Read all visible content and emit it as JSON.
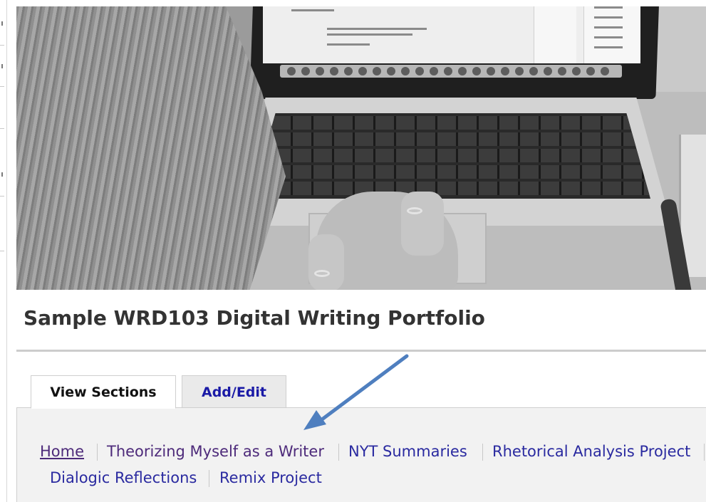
{
  "portfolio": {
    "title": "Sample WRD103 Digital Writing Portfolio"
  },
  "banner": {
    "image": "black-and-white photo of a person typing on a laptop"
  },
  "tabs": [
    {
      "label": "View Sections",
      "active": true
    },
    {
      "label": "Add/Edit",
      "active": false
    }
  ],
  "sections": [
    {
      "label": "Home",
      "current": true
    },
    {
      "label": "Theorizing Myself as a Writer"
    },
    {
      "label": "NYT Summaries"
    },
    {
      "label": "Rhetorical Analysis Project"
    },
    {
      "label": "Dialogic Reflections"
    },
    {
      "label": "Remix Project"
    }
  ],
  "annotation": {
    "arrow_color": "#4f7fbf",
    "icon": "arrow-icon"
  },
  "colors": {
    "link": "#2a2aa0",
    "visited_link": "#4d2a7a",
    "title": "#333333",
    "panel_bg": "#f2f2f2"
  }
}
